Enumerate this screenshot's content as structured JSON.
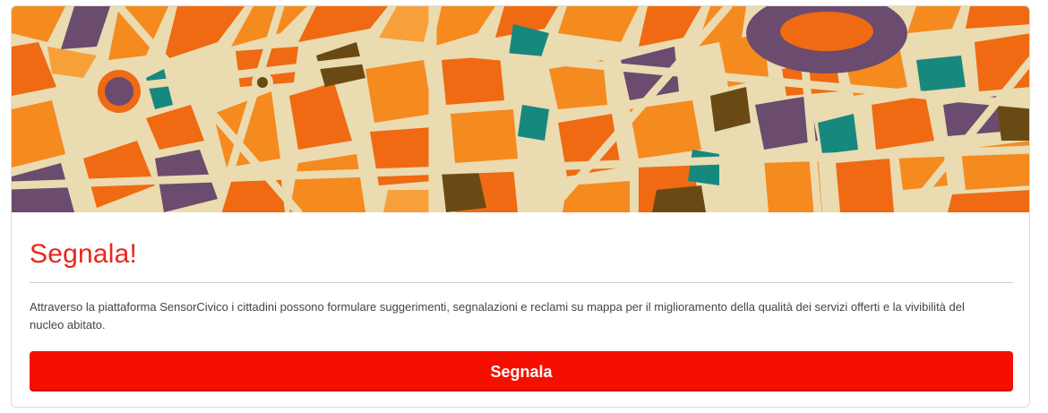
{
  "card": {
    "title": "Segnala!",
    "description": "Attraverso la piattaforma SensorCivico i cittadini possono formulare suggerimenti, segnalazioni e reclami su mappa per il miglioramento della qualità dei servizi offerti e la vivibilità del nucleo abitato.",
    "button_label": "Segnala",
    "banner_image": "stylized-city-map-illustration"
  },
  "colors": {
    "accent": "#e8261b",
    "button": "#f50f00",
    "map_road": "#eadbb0",
    "map_orange": "#f58a1f",
    "map_dark_orange": "#ef6a12",
    "map_purple": "#6b4b6e",
    "map_teal": "#17887e",
    "map_brown": "#6a4a14"
  }
}
